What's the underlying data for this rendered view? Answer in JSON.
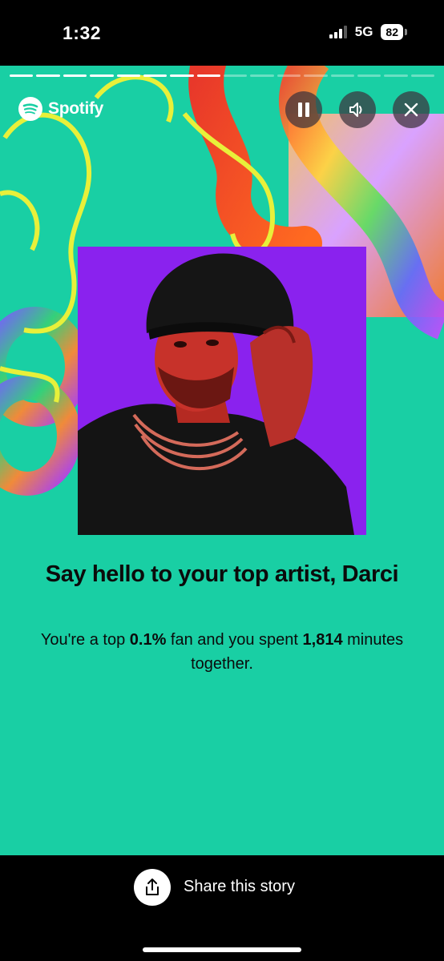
{
  "status_bar": {
    "time": "1:32",
    "network": "5G",
    "battery": "82"
  },
  "story": {
    "progress_total": 16,
    "progress_done": 8,
    "brand": "Spotify",
    "headline": "Say hello to your top artist, Darci",
    "sub_prefix": "You're a top ",
    "sub_percent": "0.1%",
    "sub_middle": " fan and you spent ",
    "sub_minutes": "1,814",
    "sub_suffix": " minutes together.",
    "controls": [
      "pause-icon",
      "sound-icon",
      "close-icon"
    ]
  },
  "bottom": {
    "share_label": "Share this story",
    "share_icon": "share-icon"
  },
  "colors": {
    "story_background": "#19cfa4",
    "photo_background": "#8a22ee",
    "accent_yellow": "#e8f03a"
  }
}
